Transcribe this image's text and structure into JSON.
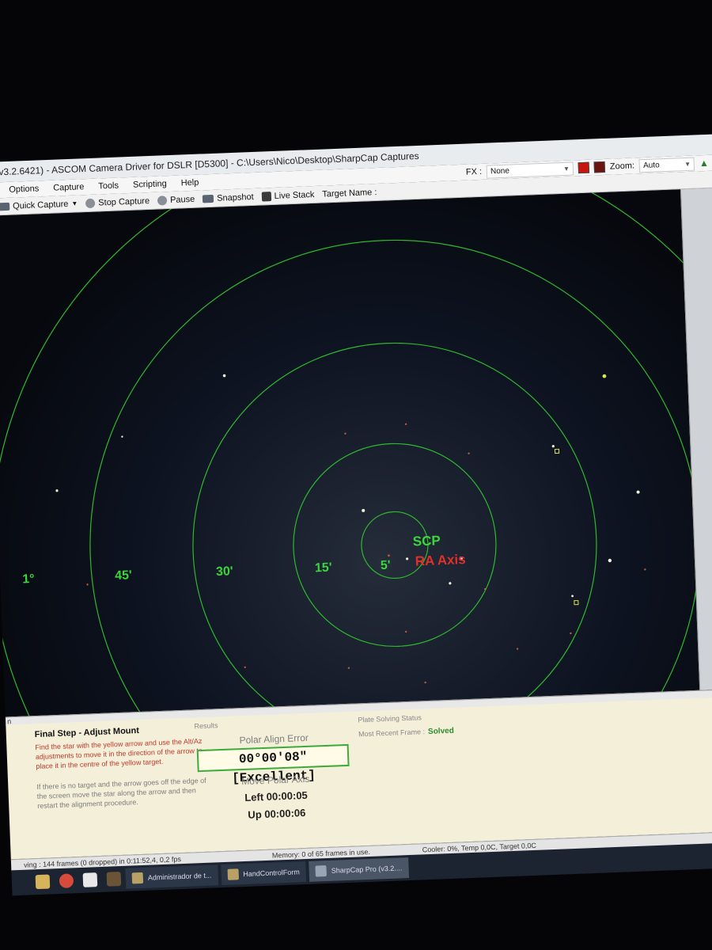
{
  "window": {
    "title": "v3.2.6421) - ASCOM Camera Driver for DSLR [D5300] - C:\\Users\\Nico\\Desktop\\SharpCap Captures"
  },
  "menu": {
    "items": [
      "Options",
      "Capture",
      "Tools",
      "Scripting",
      "Help"
    ],
    "fx_label": "FX :",
    "fx_value": "None",
    "zoom_label": "Zoom:",
    "zoom_value": "Auto"
  },
  "toolbar": {
    "quick_capture": "Quick Capture",
    "stop_capture": "Stop Capture",
    "pause": "Pause",
    "snapshot": "Snapshot",
    "live_stack": "Live Stack",
    "target_name_label": "Target Name :"
  },
  "overlay": {
    "ring_labels": [
      "1°",
      "45'",
      "30'",
      "15'",
      "5'"
    ],
    "scp_label": "SCP",
    "ra_axis_label": "RA Axis",
    "colors": {
      "rings": "#2fb82f",
      "scp": "#3ad63a",
      "ra_axis": "#e0302a"
    }
  },
  "panel": {
    "header": "n",
    "final_step_title": "Final Step - Adjust Mount",
    "instructions_red": "Find the star with the yellow arrow and use the Alt/Az adjustments to move it in the direction of the arrow to place it in the centre of the yellow target.",
    "instructions_gray": "If there is no target and the arrow goes off the edge of the screen move the star along the arrow and then restart the alignment procedure.",
    "results_label": "Results",
    "polar_align_error_label": "Polar Align Error",
    "polar_align_error_value": "00°00'08\" [Excellent]",
    "move_polar_axis_label": "Move Polar Axis",
    "left_value": "Left 00:00:05",
    "up_value": "Up 00:00:06",
    "plate_solving_label": "Plate Solving Status",
    "most_recent_frame_label": "Most Recent Frame :",
    "most_recent_frame_value": "Solved"
  },
  "status_bar": {
    "frames": "ving : 144 frames (0 dropped) in 0:11:52,4, 0,2 fps",
    "memory": "Memory: 0 of 65 frames in use.",
    "cooler": "Cooler: 0%, Temp 0,0C, Target 0,0C"
  },
  "taskbar": {
    "items": [
      "Administrador de t...",
      "HandControlForm",
      "SharpCap Pro (v3.2...."
    ]
  }
}
